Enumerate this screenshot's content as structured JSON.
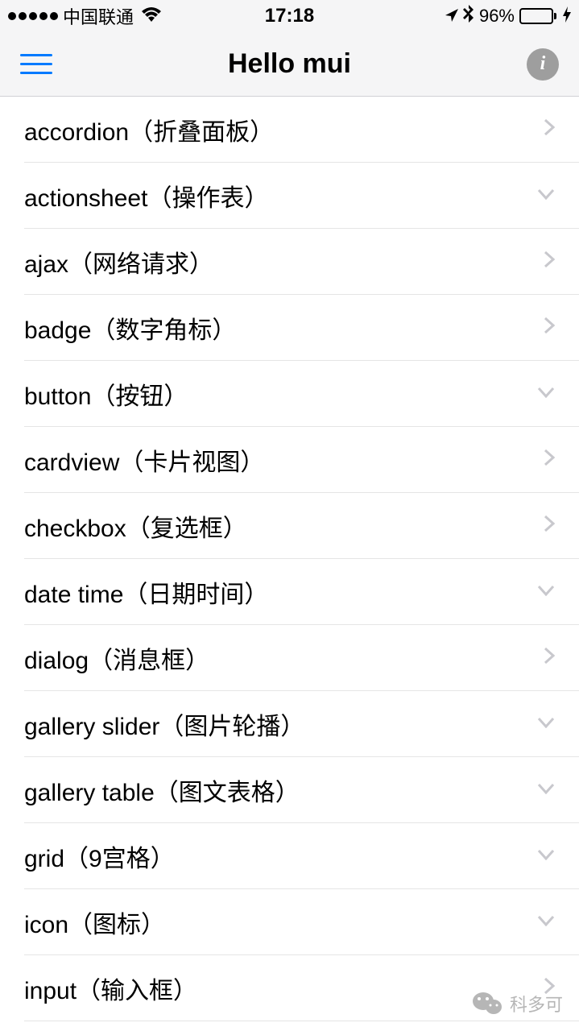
{
  "status": {
    "carrier": "中国联通",
    "time": "17:18",
    "battery": "96%"
  },
  "nav": {
    "title": "Hello mui"
  },
  "list": [
    {
      "label": "accordion（折叠面板）",
      "chevron": "right"
    },
    {
      "label": "actionsheet（操作表）",
      "chevron": "down"
    },
    {
      "label": "ajax（网络请求）",
      "chevron": "right"
    },
    {
      "label": "badge（数字角标）",
      "chevron": "right"
    },
    {
      "label": "button（按钮）",
      "chevron": "down"
    },
    {
      "label": "cardview（卡片视图）",
      "chevron": "right"
    },
    {
      "label": "checkbox（复选框）",
      "chevron": "right"
    },
    {
      "label": "date time（日期时间）",
      "chevron": "down"
    },
    {
      "label": "dialog（消息框）",
      "chevron": "right"
    },
    {
      "label": "gallery slider（图片轮播）",
      "chevron": "down"
    },
    {
      "label": "gallery table（图文表格）",
      "chevron": "down"
    },
    {
      "label": "grid（9宫格）",
      "chevron": "down"
    },
    {
      "label": "icon（图标）",
      "chevron": "down"
    },
    {
      "label": "input（输入框）",
      "chevron": "right"
    }
  ],
  "watermark": {
    "text": "科多可"
  }
}
